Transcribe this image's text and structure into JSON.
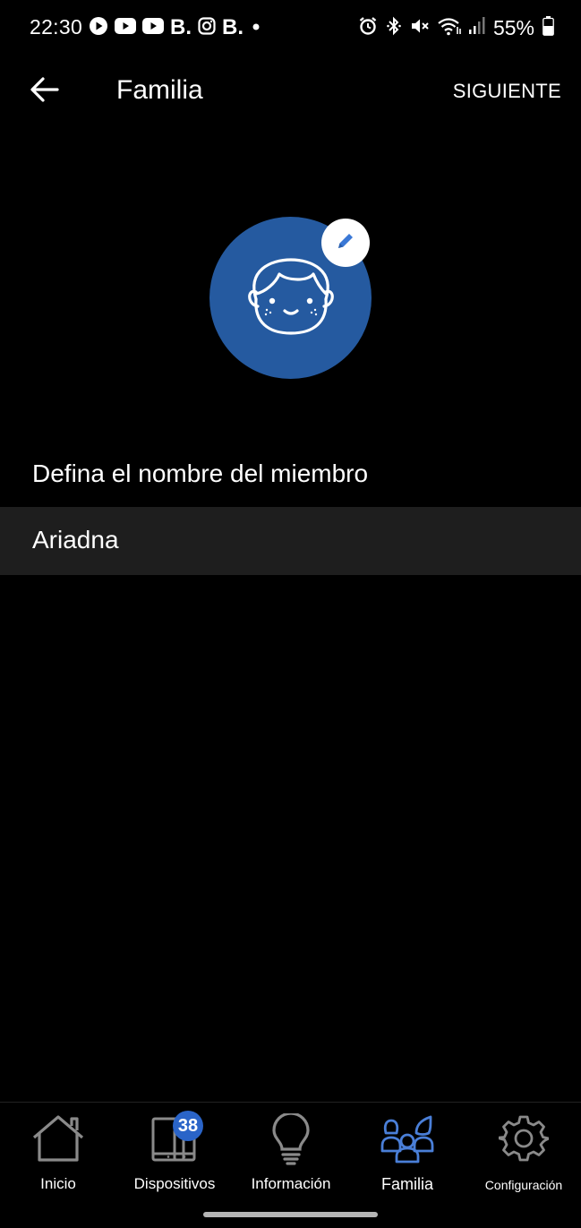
{
  "status_bar": {
    "time": "22:30",
    "left_icons": [
      "play-circle-icon",
      "youtube-icon",
      "youtube-icon",
      "b-app-icon",
      "instagram-icon",
      "b-app-icon",
      "dot-icon"
    ],
    "b_letter": "B.",
    "right_icons": [
      "alarm-icon",
      "bluetooth-icon",
      "mute-icon",
      "wifi-icon",
      "signal-icon",
      "battery-icon"
    ],
    "battery_percent": "55%"
  },
  "app_bar": {
    "title": "Familia",
    "next_label": "SIGUIENTE"
  },
  "profile": {
    "avatar_icon": "child-face-icon",
    "avatar_color": "#255aa0",
    "edit_icon": "pencil-icon"
  },
  "form": {
    "label": "Defina el nombre del miembro",
    "name_value": "Ariadna"
  },
  "bottom_nav": {
    "items": [
      {
        "label": "Inicio",
        "icon": "home-icon"
      },
      {
        "label": "Dispositivos",
        "icon": "devices-icon",
        "badge": "38"
      },
      {
        "label": "Información",
        "icon": "lightbulb-icon"
      },
      {
        "label": "Familia",
        "icon": "family-icon",
        "active": true
      },
      {
        "label": "Configuración",
        "icon": "gear-icon"
      }
    ],
    "active_color": "#4a7fd8"
  }
}
